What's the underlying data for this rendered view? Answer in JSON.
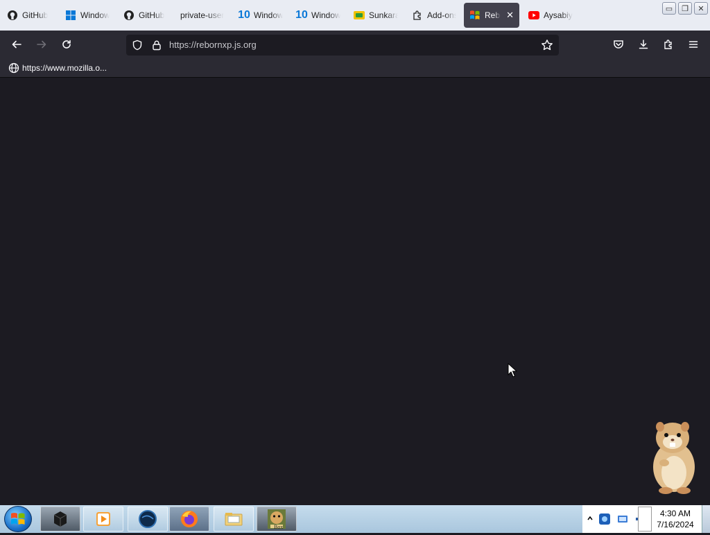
{
  "browser": {
    "tabs": [
      {
        "label": "GitHub",
        "favicon": "github-icon"
      },
      {
        "label": "Windows",
        "favicon": "windows-icon"
      },
      {
        "label": "GitHub",
        "favicon": "github-icon"
      },
      {
        "label": "private-user",
        "favicon": "none"
      },
      {
        "label": "Windows",
        "favicon": "windows10-icon"
      },
      {
        "label": "Windows",
        "favicon": "windows10-icon"
      },
      {
        "label": "Sunkara",
        "favicon": "sunkara-icon"
      },
      {
        "label": "Add-ons",
        "favicon": "puzzle-icon"
      },
      {
        "label": "Reborn",
        "favicon": "windows-xp-icon",
        "active": true
      },
      {
        "label": "Aysabiy",
        "favicon": "youtube-icon"
      }
    ],
    "tab_close_glyph": "✕",
    "url": "https://rebornxp.js.org",
    "bookmarks": [
      {
        "label": "https://www.mozilla.o..."
      }
    ]
  },
  "window_controls": {
    "minimize": "▭",
    "restore": "❐",
    "close": "✕"
  },
  "taskbar": {
    "items": [
      {
        "name": "cube-app-icon"
      },
      {
        "name": "media-player-icon"
      },
      {
        "name": "globe-app-icon"
      },
      {
        "name": "firefox-icon"
      },
      {
        "name": "file-explorer-icon"
      },
      {
        "name": "hamster-box-icon",
        "label": "Box"
      }
    ],
    "clock": {
      "time": "4:30 AM",
      "date": "7/16/2024"
    }
  },
  "colors": {
    "browser_chrome": "#2b2a33",
    "page_background": "#1c1b22",
    "active_tab": "#42414d",
    "taskbar": "#b8d2e6"
  }
}
